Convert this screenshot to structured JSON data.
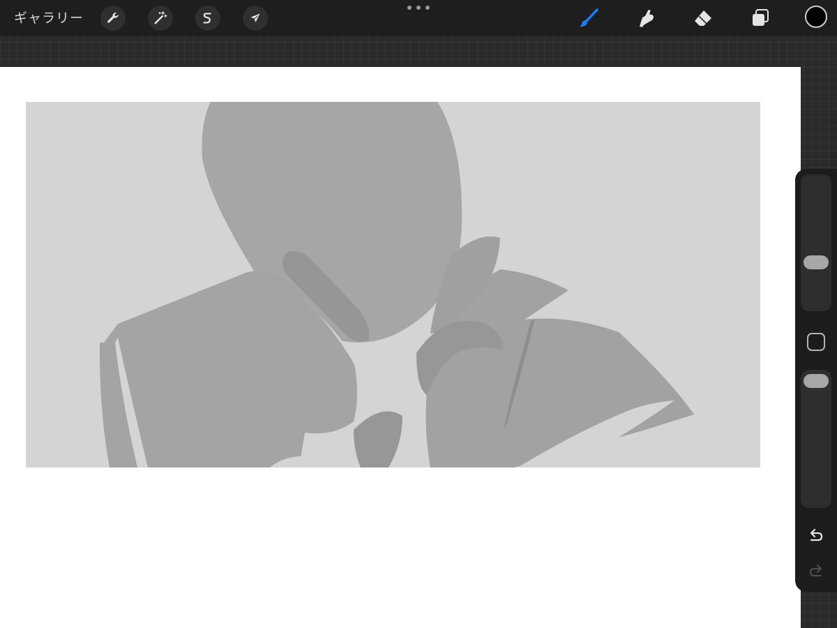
{
  "toolbar": {
    "gallery_label": "ギャラリー",
    "left_tools": [
      {
        "name": "actions",
        "icon": "wrench-icon"
      },
      {
        "name": "adjustments",
        "icon": "magic-wand-icon"
      },
      {
        "name": "selection",
        "icon": "selection-s-icon"
      },
      {
        "name": "transform",
        "icon": "arrow-cursor-icon"
      }
    ],
    "right_tools": [
      {
        "name": "brush",
        "icon": "brush-icon",
        "active": true
      },
      {
        "name": "smudge",
        "icon": "smudge-hand-icon",
        "active": false
      },
      {
        "name": "eraser",
        "icon": "eraser-icon",
        "active": false
      },
      {
        "name": "layers",
        "icon": "layers-icon",
        "active": false
      }
    ],
    "current_color": "#000000",
    "active_tool_color": "#1d7cf2"
  },
  "canvas": {
    "page_color": "#ffffff",
    "artwork_background": "#d4d4d4",
    "figure_color": "#a6a6a6",
    "figure_shadow_color": "#989898"
  },
  "sidebar": {
    "brush_size_level": 0.6,
    "opacity_level": 1.0,
    "modify_icon": "square-icon",
    "undo_icon": "undo-icon",
    "redo_icon": "redo-icon",
    "redo_enabled": false
  }
}
